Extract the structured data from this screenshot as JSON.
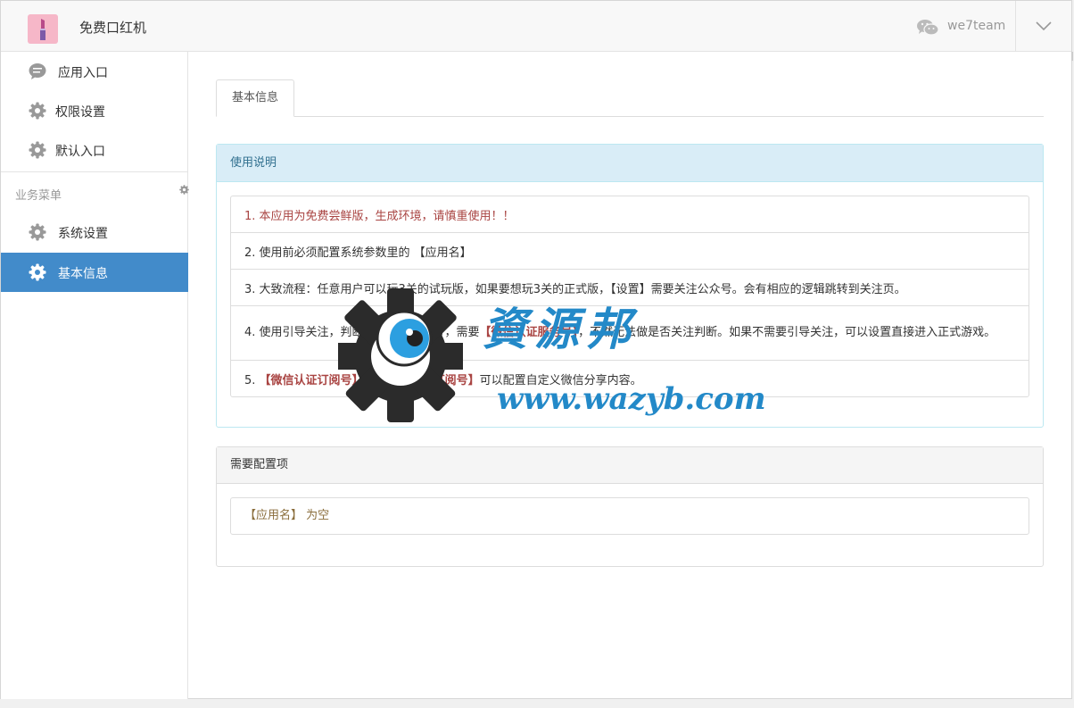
{
  "header": {
    "app_title": "免费口红机",
    "username": "we7team",
    "logo_icon": "lipstick-icon",
    "wechat_icon": "wechat-icon",
    "menu_icon": "chevron-down-icon"
  },
  "sidebar": {
    "items_top": [
      {
        "label": "应用入口",
        "icon": "chat-bubble-icon"
      },
      {
        "label": "权限设置",
        "icon": "gear-icon"
      },
      {
        "label": "默认入口",
        "icon": "gear-icon"
      }
    ],
    "section_label": "业务菜单",
    "items_section": [
      {
        "label": "系统设置",
        "icon": "gear-icon"
      },
      {
        "label": "基本信息",
        "icon": "gear-icon",
        "active": true
      }
    ]
  },
  "tabs": [
    {
      "label": "基本信息"
    }
  ],
  "usage_panel": {
    "title": "使用说明",
    "items": {
      "i1": "1. 本应用为免费尝鲜版，生成环境，请慎重使用！！",
      "i2": "2. 使用前必须配置系统参数里的 【应用名】",
      "i3": "3. 大致流程：任意用户可以玩3关的试玩版，如果要想玩3关的正式版，【设置】需要关注公众号。会有相应的逻辑跳转到关注页。",
      "i4a": "4. 使用引导关注，判断是否关注公众号，需要",
      "i4b": "【微信认证服务号】",
      "i4c": "，不然无法做是否关注判断。如果不需要引导关注，可以设置直接进入正式游戏。",
      "i5a": "5. ",
      "i5b": "【微信认证订阅号】",
      "i5c": "或",
      "i5d": "【微信认证订阅号】",
      "i5e": "可以配置自定义微信分享内容。"
    }
  },
  "config_panel": {
    "title": "需要配置项",
    "item": "【应用名】 为空"
  },
  "watermark": {
    "title": "資源邦",
    "url": "www.wazyb.com"
  },
  "colors": {
    "active_blue": "#428bca",
    "info_bg": "#d9edf7",
    "danger_text": "#a94442",
    "warning_text": "#8a6d3b"
  }
}
